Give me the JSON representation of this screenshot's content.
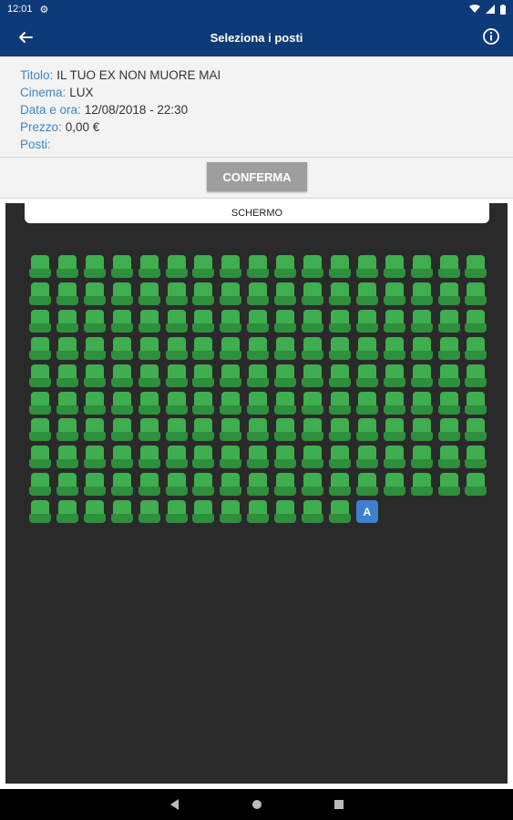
{
  "status_bar": {
    "time": "12:01"
  },
  "app_bar": {
    "title": "Seleziona i posti"
  },
  "info": {
    "titolo_label": "Titolo:",
    "titolo_value": "IL TUO EX NON MUORE MAI",
    "cinema_label": "Cinema:",
    "cinema_value": "LUX",
    "data_label": "Data e ora:",
    "data_value": "12/08/2018 - 22:30",
    "prezzo_label": "Prezzo:",
    "prezzo_value": "0,00 €",
    "posti_label": "Posti:",
    "posti_value": ""
  },
  "confirm": {
    "label": "CONFERMA"
  },
  "hall": {
    "screen_label": "SCHERMO",
    "rows": [
      [
        "free",
        "free",
        "free",
        "free",
        "free",
        "free",
        "free",
        "free",
        "free",
        "free",
        "free",
        "free",
        "free",
        "free",
        "free",
        "free",
        "free"
      ],
      [
        "free",
        "free",
        "free",
        "free",
        "free",
        "free",
        "free",
        "free",
        "free",
        "free",
        "free",
        "free",
        "free",
        "free",
        "free",
        "free",
        "free"
      ],
      [
        "free",
        "free",
        "free",
        "free",
        "free",
        "free",
        "free",
        "free",
        "free",
        "free",
        "free",
        "free",
        "free",
        "free",
        "free",
        "free",
        "free"
      ],
      [
        "free",
        "free",
        "free",
        "free",
        "free",
        "free",
        "free",
        "free",
        "free",
        "free",
        "free",
        "free",
        "free",
        "free",
        "free",
        "free",
        "free"
      ],
      [
        "free",
        "free",
        "free",
        "free",
        "free",
        "free",
        "free",
        "free",
        "free",
        "free",
        "free",
        "free",
        "free",
        "free",
        "free",
        "free",
        "free"
      ],
      [
        "free",
        "free",
        "free",
        "free",
        "free",
        "free",
        "free",
        "free",
        "free",
        "free",
        "free",
        "free",
        "free",
        "free",
        "free",
        "free",
        "free"
      ],
      [
        "free",
        "free",
        "free",
        "free",
        "free",
        "free",
        "free",
        "free",
        "free",
        "free",
        "free",
        "free",
        "free",
        "free",
        "free",
        "free",
        "free"
      ],
      [
        "free",
        "free",
        "free",
        "free",
        "free",
        "free",
        "free",
        "free",
        "free",
        "free",
        "free",
        "free",
        "free",
        "free",
        "free",
        "free",
        "free"
      ],
      [
        "free",
        "free",
        "free",
        "free",
        "free",
        "free",
        "free",
        "free",
        "free",
        "free",
        "free",
        "free",
        "free",
        "free",
        "free",
        "free",
        "free"
      ],
      [
        "free",
        "free",
        "free",
        "free",
        "free",
        "free",
        "free",
        "free",
        "free",
        "free",
        "free",
        "free",
        "assigned"
      ]
    ],
    "assigned_label": "A",
    "colors": {
      "free_seat": "#3fae4f",
      "assigned_seat": "#3f7fcf",
      "hall_bg": "#2a2a2a"
    }
  },
  "theme": {
    "primary": "#0d3a78",
    "label_color": "#3b87c7"
  },
  "icons": {
    "back": "arrow-left-icon",
    "info": "info-circle-icon",
    "settings": "gear-icon",
    "wifi": "wifi-icon",
    "signal": "signal-icon",
    "battery": "battery-icon"
  }
}
